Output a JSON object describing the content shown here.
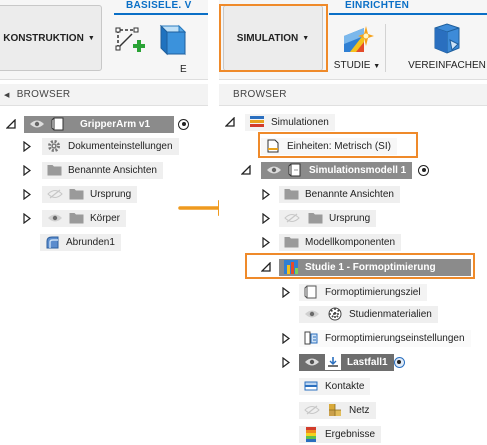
{
  "colors": {
    "accent": "#0a6fc6",
    "highlight": "#ef8a2a",
    "arrow": "#ef9a1e"
  },
  "left": {
    "workspace_button": {
      "label": "KONSTRUKTION",
      "icon": "chevron-down-icon"
    },
    "toolbar": {
      "group_label": "BASISELE. V",
      "tool_label": "E"
    },
    "browser_header": "BROWSER",
    "tree": [
      {
        "label": "GripperArm v1",
        "icon": "component-icon"
      },
      {
        "label": "Dokumenteinstellungen",
        "icon": "gear-icon"
      },
      {
        "label": "Benannte Ansichten",
        "icon": "folder-icon"
      },
      {
        "label": "Ursprung",
        "icon": "folder-icon"
      },
      {
        "label": "Körper",
        "icon": "folder-icon"
      },
      {
        "label": "Abrunden1",
        "icon": "fillet-icon"
      }
    ]
  },
  "right": {
    "workspace_button": {
      "label": "SIMULATION",
      "icon": "chevron-down-icon"
    },
    "toolbar": {
      "group_label": "EINRICHTEN",
      "tools": [
        {
          "label": "STUDIE",
          "icon": "study-icon",
          "has_dropdown": true
        },
        {
          "label": "VEREINFACHEN",
          "icon": "simplify-icon",
          "has_dropdown": false
        }
      ]
    },
    "browser_header": "BROWSER",
    "tree": [
      {
        "label": "Simulationen",
        "icon": "simulations-icon"
      },
      {
        "label": "Einheiten: Metrisch (SI)",
        "icon": "document-icon"
      },
      {
        "label": "Simulationsmodell 1",
        "icon": "component-icon"
      },
      {
        "label": "Benannte Ansichten",
        "icon": "folder-icon"
      },
      {
        "label": "Ursprung",
        "icon": "folder-icon"
      },
      {
        "label": "Modellkomponenten",
        "icon": "folder-icon"
      },
      {
        "label": "Studie 1 - Formoptimierung",
        "icon": "study-icon"
      },
      {
        "label": "Formoptimierungsziel",
        "icon": "target-icon"
      },
      {
        "label": "Studienmaterialien",
        "icon": "materials-icon"
      },
      {
        "label": "Formoptimierungseinstellungen",
        "icon": "settings-icon"
      },
      {
        "label": "Lastfall1",
        "icon": "load-case-icon"
      },
      {
        "label": "Kontakte",
        "icon": "contacts-icon"
      },
      {
        "label": "Netz",
        "icon": "mesh-icon"
      },
      {
        "label": "Ergebnisse",
        "icon": "results-icon"
      }
    ]
  }
}
